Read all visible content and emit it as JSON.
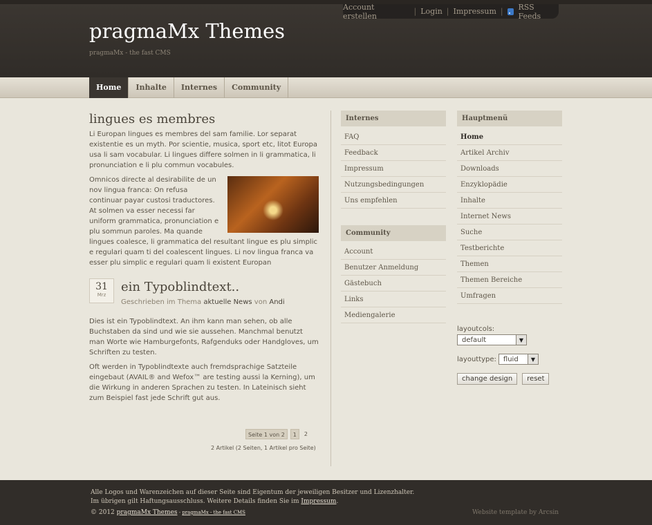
{
  "toplinks": {
    "account": "Account erstellen",
    "login": "Login",
    "impressum": "Impressum",
    "rss": "RSS Feeds"
  },
  "site": {
    "title": "pragmaMx Themes",
    "slogan": "pragmaMx - the fast CMS"
  },
  "nav": [
    "Home",
    "Inhalte",
    "Internes",
    "Community"
  ],
  "article": {
    "title": "lingues es membres",
    "p1": "Li Europan lingues es membres del sam familie. Lor separat existentie es un myth. Por scientie, musica, sport etc, litot Europa usa li sam vocabular. Li lingues differe solmen in li grammatica, li pronunciation e li plu commun vocabules.",
    "p2": "Omnicos directe al desirabilite de un nov lingua franca: On refusa continuar payar custosi traductores. At solmen va esser necessi far uniform grammatica, pronunciation e plu sommun paroles. Ma quande lingues coalesce, li grammatica del resultant lingue es plu simplic e regulari quam ti del coalescent lingues. Li nov lingua franca va esser plu simplic e regulari quam li existent Europan"
  },
  "post": {
    "day": "31",
    "month": "Mrz",
    "title": "ein Typoblindtext..",
    "meta_prefix": "Geschrieben im Thema",
    "topic": "aktuelle News",
    "meta_by": "von",
    "author": "Andi",
    "p1": "Dies ist ein Typoblindtext. An ihm kann man sehen, ob alle Buchstaben da sind und wie sie aussehen. Manchmal benutzt man Worte wie Hamburgefonts, Rafgenduks oder Handgloves, um Schriften zu testen.",
    "p2": "Oft werden in Typoblindtexte auch fremdsprachige Satzteile eingebaut (AVAIL® and Wefox™ are testing aussi la Kerning), um die Wirkung in anderen Sprachen zu testen. In Lateinisch sieht zum Beispiel fast jede Schrift gut aus."
  },
  "pagination": {
    "info": "Seite 1 von 2",
    "current": "1",
    "next": "2",
    "count": "2 Artikel (2 Seiten, 1 Artikel pro Seite)"
  },
  "blocks": {
    "internes": {
      "title": "Internes",
      "items": [
        "FAQ",
        "Feedback",
        "Impressum",
        "Nutzungsbedingungen",
        "Uns empfehlen"
      ]
    },
    "community": {
      "title": "Community",
      "items": [
        "Account",
        "Benutzer Anmeldung",
        "Gästebuch",
        "Links",
        "Mediengalerie"
      ]
    },
    "hauptmenu": {
      "title": "Hauptmenü",
      "items": [
        "Home",
        "Artikel Archiv",
        "Downloads",
        "Enzyklopädie",
        "Inhalte",
        "Internet News",
        "Suche",
        "Testberichte",
        "Themen",
        "Themen Bereiche",
        "Umfragen"
      ]
    }
  },
  "layout_form": {
    "cols_label": "layoutcols:",
    "cols_value": "default",
    "type_label": "layouttype:",
    "type_value": "fluid",
    "change_button": "change design",
    "reset_button": "reset"
  },
  "footer": {
    "line1": "Alle Logos und Warenzeichen auf dieser Seite sind Eigentum der jeweiligen Besitzer und Lizenzhalter.",
    "line2_prefix": "Im übrigen gilt Haftungsausschluss. Weitere Details finden Sie im",
    "line2_link": "Impressum",
    "line2_suffix": ".",
    "copyright": "© 2012",
    "brand": "pragmaMx Themes",
    "brand_sep": " - ",
    "brand_small": "pragmaMx - the fast CMS",
    "credit": "Website template by Arcsin"
  },
  "colors": {
    "header_bg": "#302c28",
    "page_bg": "#e9e6dc",
    "nav_active_bg": "#3a3530",
    "block_title_bg": "#d7d2c4"
  }
}
